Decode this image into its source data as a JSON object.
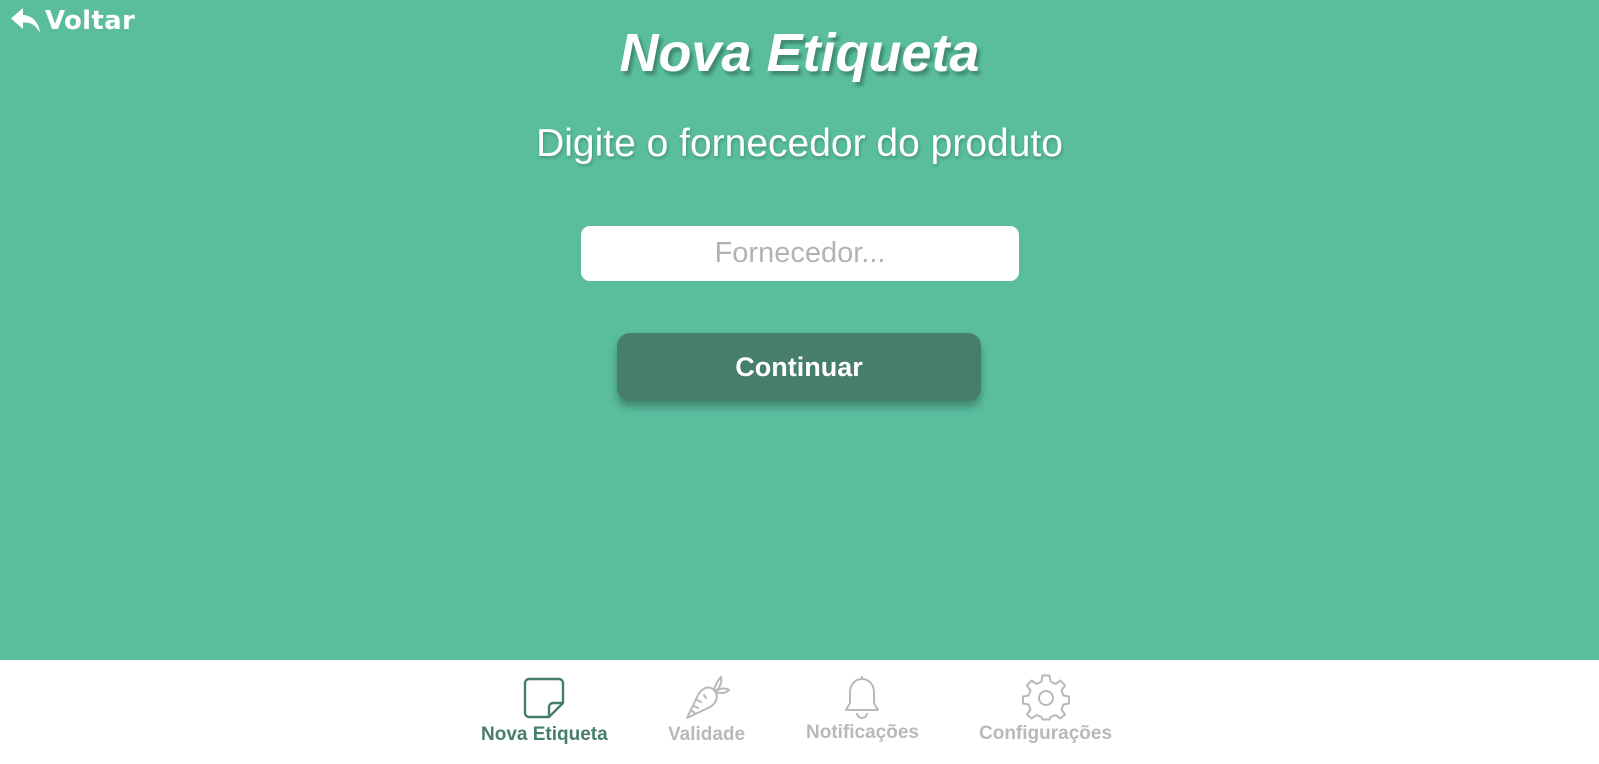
{
  "header": {
    "back_label": "Voltar",
    "title": "Nova Etiqueta"
  },
  "main": {
    "prompt": "Digite o fornecedor do produto",
    "supplier_input": {
      "value": "",
      "placeholder": "Fornecedor..."
    },
    "continue_label": "Continuar"
  },
  "tabbar": {
    "tabs": [
      {
        "label": "Nova Etiqueta",
        "icon": "sticky-note-icon",
        "active": true
      },
      {
        "label": "Validade",
        "icon": "carrot-icon",
        "active": false
      },
      {
        "label": "Notificações",
        "icon": "bell-icon",
        "active": false
      },
      {
        "label": "Configurações",
        "icon": "gear-icon",
        "active": false
      }
    ]
  },
  "colors": {
    "background": "#59bd9e",
    "button": "#467d6b",
    "tab_active": "#467d6b",
    "tab_inactive": "#b9b9b9"
  }
}
